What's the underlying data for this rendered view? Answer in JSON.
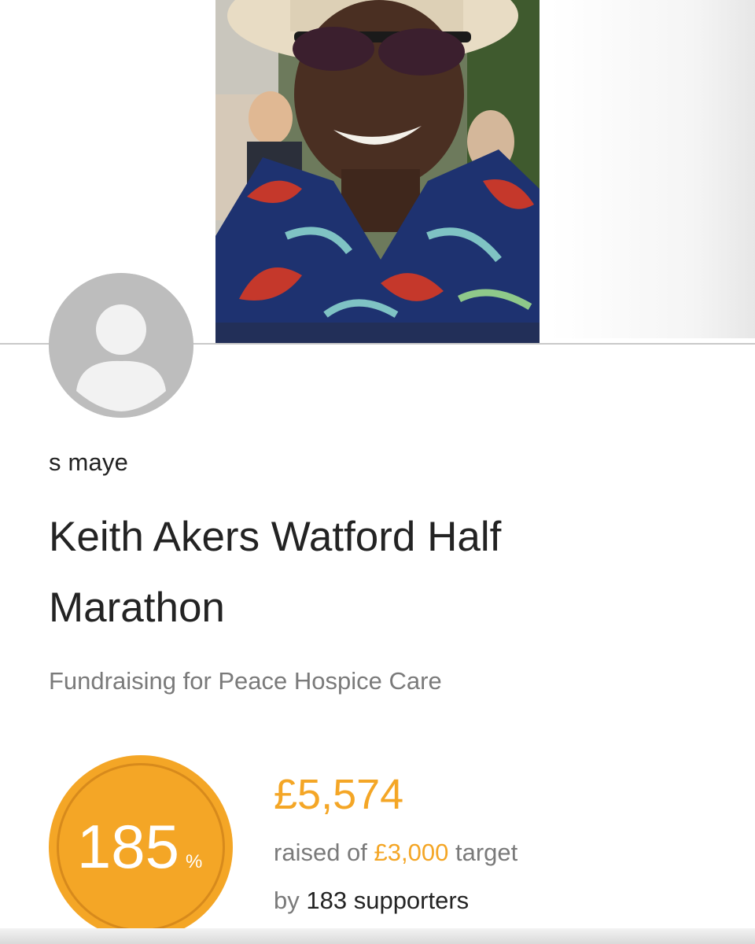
{
  "owner": {
    "name": "s maye"
  },
  "page": {
    "title": "Keith Akers Watford Half Marathon",
    "charity_line": "Fundraising for Peace Hospice Care"
  },
  "progress": {
    "percent": "185",
    "percent_symbol": "%",
    "raised_amount": "£5,574",
    "raised_prefix": "raised of",
    "target_amount": "£3,000",
    "target_suffix": "target",
    "supporters_prefix": "by",
    "supporters_text": "183 supporters",
    "fraction_of_target": 1.85
  },
  "colors": {
    "accent": "#f4a626",
    "accent_ring": "#d78a1c",
    "text_dark": "#232323",
    "text_muted": "#7a7a7a",
    "avatar_bg": "#bdbdbd"
  },
  "icons": {
    "avatar": "default-user-icon"
  }
}
